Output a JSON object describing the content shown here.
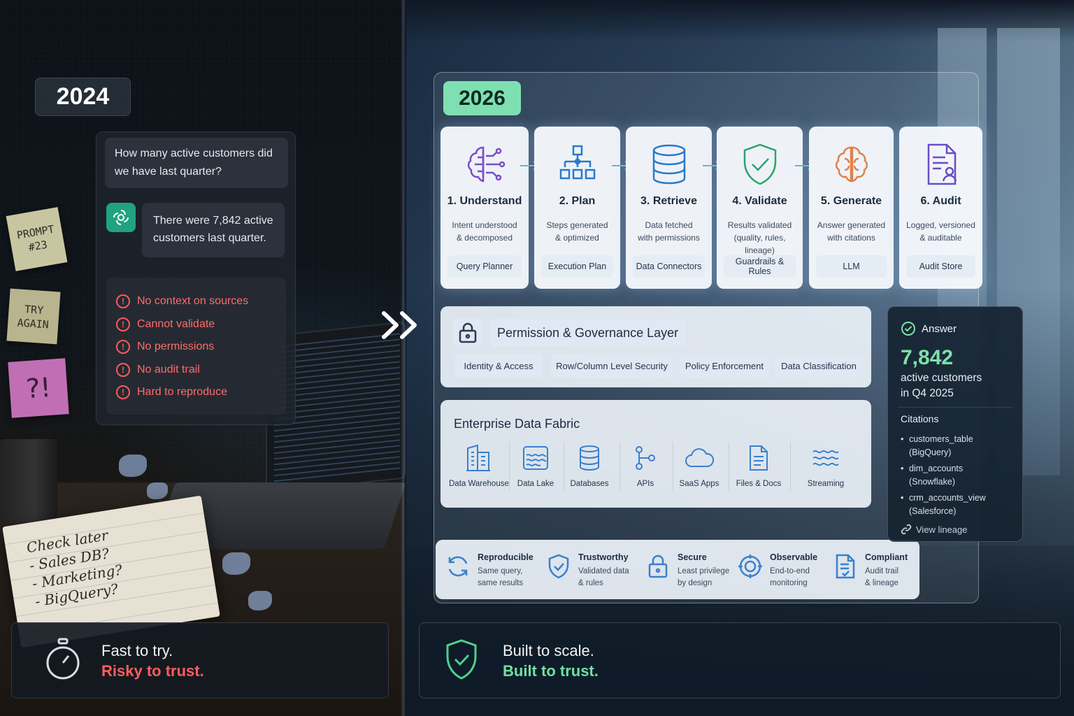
{
  "left": {
    "year": "2024",
    "question": "How many active customers did we have last quarter?",
    "answer": "There were 7,842 active customers last quarter.",
    "issues": [
      "No context on sources",
      "Cannot validate",
      "No permissions",
      "No audit trail",
      "Hard to reproduce"
    ],
    "sticky_notes": [
      "PROMPT #23",
      "TRY AGAIN",
      "?!"
    ],
    "notebook_lines": [
      "Check later",
      "- Sales DB?",
      "- Marketing?",
      "- BigQuery?"
    ],
    "tagline_1": "Fast to try.",
    "tagline_2": "Risky to trust."
  },
  "right": {
    "year": "2026",
    "steps": [
      {
        "title": "1. Understand",
        "desc_1": "Intent understood",
        "desc_2": "& decomposed",
        "tag": "Query Planner",
        "icon": "brain-circuit-icon"
      },
      {
        "title": "2. Plan",
        "desc_1": "Steps generated",
        "desc_2": "& optimized",
        "tag": "Execution Plan",
        "icon": "hierarchy-icon"
      },
      {
        "title": "3. Retrieve",
        "desc_1": "Data fetched",
        "desc_2": "with permissions",
        "tag": "Data Connectors",
        "icon": "database-icon"
      },
      {
        "title": "4. Validate",
        "desc_1": "Results validated",
        "desc_2": "(quality, rules, lineage)",
        "tag": "Guardrails & Rules",
        "icon": "shield-check-icon"
      },
      {
        "title": "5. Generate",
        "desc_1": "Answer generated",
        "desc_2": "with citations",
        "tag": "LLM",
        "icon": "brain-icon"
      },
      {
        "title": "6. Audit",
        "desc_1": "Logged, versioned",
        "desc_2": "& auditable",
        "tag": "Audit Store",
        "icon": "document-user-icon"
      }
    ],
    "governance": {
      "title": "Permission & Governance Layer",
      "chips": [
        "Identity & Access",
        "Row/Column Level Security",
        "Policy Enforcement",
        "Data Classification"
      ]
    },
    "fabric": {
      "title": "Enterprise Data Fabric",
      "sources": [
        "Data Warehouse",
        "Data Lake",
        "Databases",
        "APIs",
        "SaaS Apps",
        "Files & Docs",
        "Streaming"
      ]
    },
    "properties": [
      {
        "title": "Reproducible",
        "d1": "Same query,",
        "d2": "same results"
      },
      {
        "title": "Trustworthy",
        "d1": "Validated data",
        "d2": "& rules"
      },
      {
        "title": "Secure",
        "d1": "Least privilege",
        "d2": "by design"
      },
      {
        "title": "Observable",
        "d1": "End-to-end",
        "d2": "monitoring"
      },
      {
        "title": "Compliant",
        "d1": "Audit trail",
        "d2": "& lineage"
      }
    ],
    "answer": {
      "header": "Answer",
      "value": "7,842",
      "sub_1": "active customers",
      "sub_2": "in Q4 2025",
      "citations_label": "Citations",
      "citations": [
        {
          "name": "customers_table",
          "src": "(BigQuery)"
        },
        {
          "name": "dim_accounts",
          "src": "(Snowflake)"
        },
        {
          "name": "crm_accounts_view",
          "src": "(Salesforce)"
        }
      ],
      "lineage_link": "View lineage"
    },
    "tagline_1": "Built to scale.",
    "tagline_2": "Built to trust."
  },
  "colors": {
    "risk_red": "#ff5d5d",
    "trust_green": "#6fe0a2",
    "year_2026_bg": "#7ee0b2",
    "openai_green": "#20a37f"
  }
}
